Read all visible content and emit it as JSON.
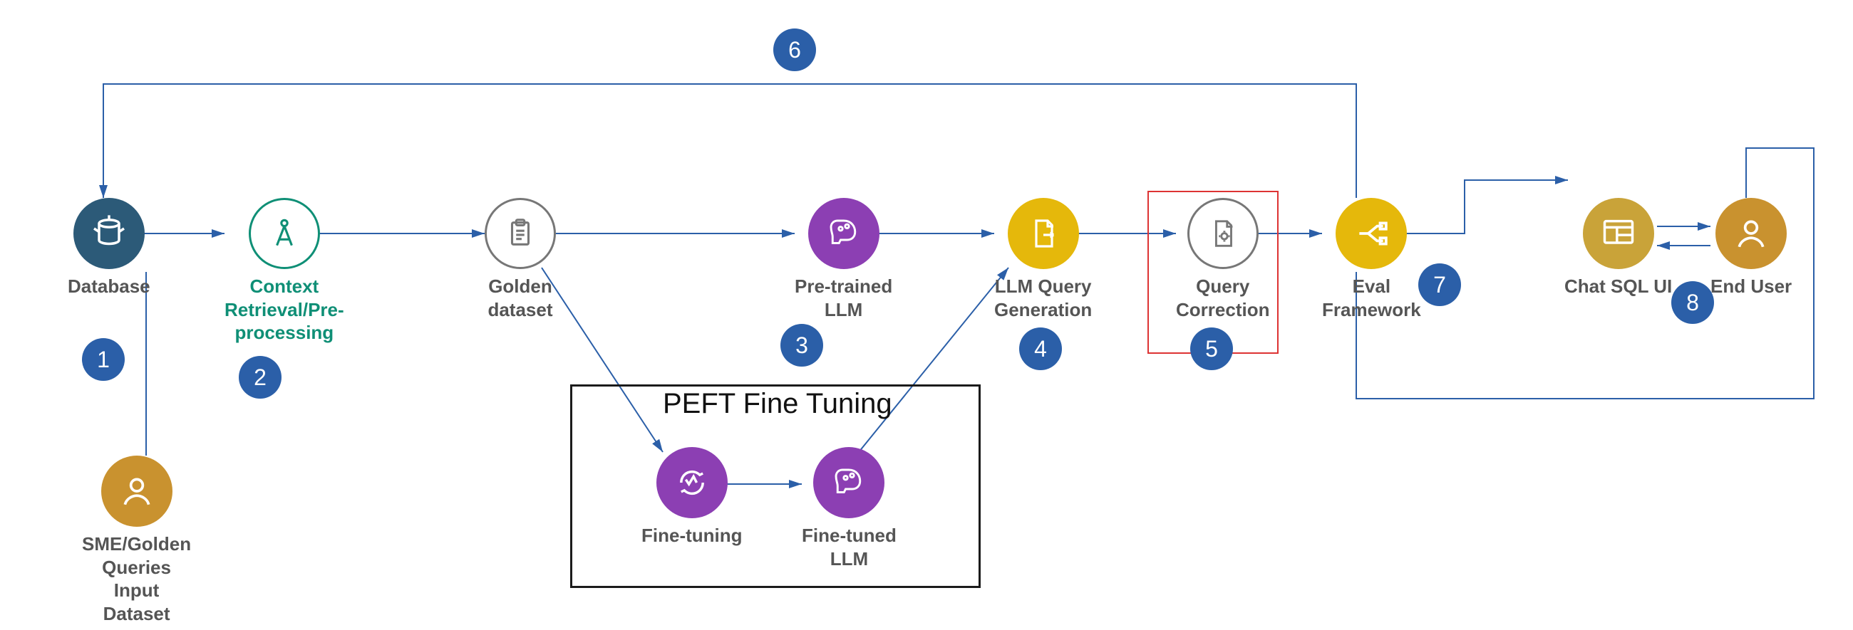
{
  "nodes": {
    "database": {
      "label": "Database"
    },
    "context": {
      "label": "Context\nRetrieval/Pre-\nprocessing"
    },
    "golden": {
      "label": "Golden\ndataset"
    },
    "pretrained": {
      "label": "Pre-trained\nLLM"
    },
    "llmq": {
      "label": "LLM Query\nGeneration"
    },
    "qcorr": {
      "label": "Query\nCorrection"
    },
    "eval": {
      "label": "Eval\nFramework"
    },
    "chatui": {
      "label": "Chat SQL UI"
    },
    "enduser": {
      "label": "End User"
    },
    "sme": {
      "label": "SME/Golden\nQueries\nInput\nDataset"
    },
    "finetuning": {
      "label": "Fine-tuning"
    },
    "finetuned": {
      "label": "Fine-tuned\nLLM"
    }
  },
  "steps": {
    "s1": "1",
    "s2": "2",
    "s3": "3",
    "s4": "4",
    "s5": "5",
    "s6": "6",
    "s7": "7",
    "s8": "8"
  },
  "peft_title": "PEFT Fine Tuning"
}
